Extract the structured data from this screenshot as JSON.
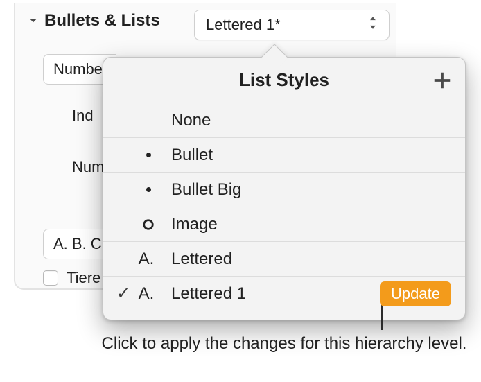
{
  "section": {
    "title": "Bullets & Lists",
    "selected": "Lettered 1*"
  },
  "fields": {
    "number_prefix": "Numbe",
    "indent": "Ind",
    "numbers": "Num",
    "letters": "A. B. C.",
    "tiered": "Tiere"
  },
  "popover": {
    "title": "List Styles",
    "items": [
      {
        "name": "None",
        "prefix": "",
        "icon": ""
      },
      {
        "name": "Bullet",
        "prefix": "",
        "icon": "dot"
      },
      {
        "name": "Bullet Big",
        "prefix": "",
        "icon": "dot"
      },
      {
        "name": "Image",
        "prefix": "",
        "icon": "ring"
      },
      {
        "name": "Lettered",
        "prefix": "A.",
        "icon": ""
      },
      {
        "name": "Lettered 1",
        "prefix": "A.",
        "icon": "",
        "checked": true,
        "update": true
      }
    ],
    "update_label": "Update"
  },
  "caption": "Click to apply the changes for this hierarchy level."
}
